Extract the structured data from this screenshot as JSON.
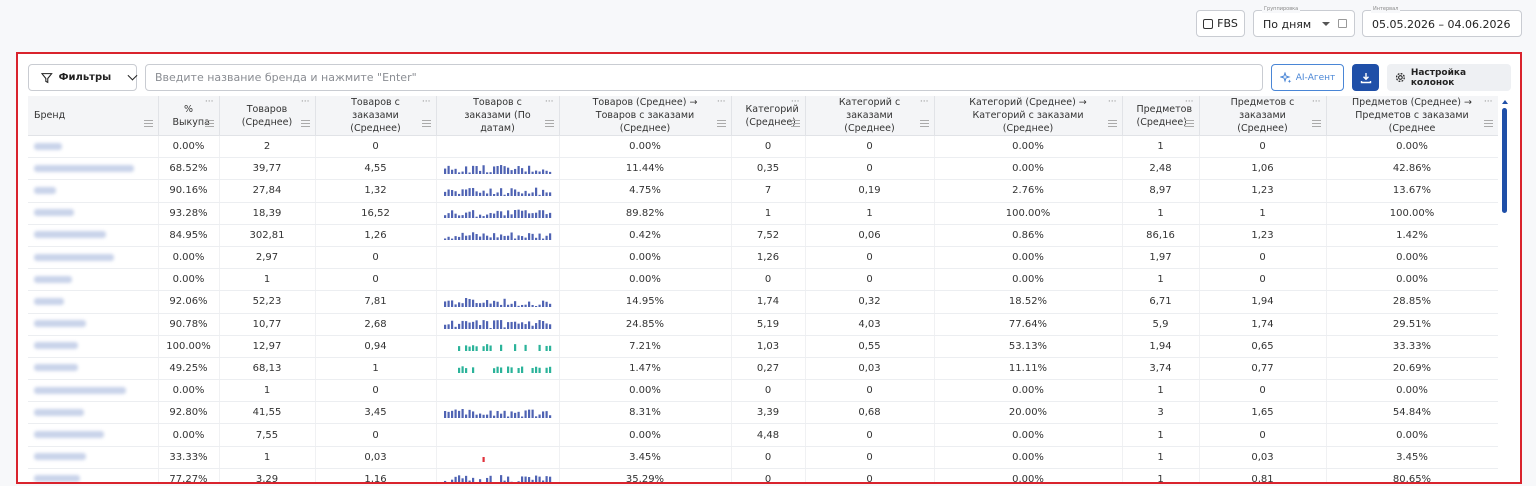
{
  "toolbar": {
    "fbs_label": "FBS",
    "grouping_label": "Группировка",
    "grouping_value": "По дням",
    "interval_label": "Интервал",
    "interval_value": "05.05.2026 – 04.06.2026"
  },
  "panel": {
    "filters_label": "Фильтры",
    "search_placeholder": "Введите название бренда и нажмите \"Enter\"",
    "ai_label": "AI-Агент",
    "columns_settings_label": "Настройка колонок"
  },
  "colors": {
    "accent": "#1f4fa8",
    "spark_blue": "#4f63b3",
    "spark_teal": "#2bb39a",
    "spark_red": "#e0323c",
    "highlight_border": "#d9232d"
  },
  "table": {
    "headers": [
      "Бренд",
      "% Выкупа",
      "Товаров (Среднее)",
      "Товаров с заказами (Среднее)",
      "Товаров с заказами (По датам)",
      "Товаров (Среднее) → Товаров с заказами (Среднее)",
      "Категорий (Среднее)",
      "Категорий с заказами (Среднее)",
      "Категорий (Среднее) → Категорий с заказами (Среднее)",
      "Предметов (Среднее)",
      "Предметов с заказами (Среднее)",
      "Предметов (Среднее) → Предметов с заказами (Среднее"
    ],
    "rows": [
      {
        "buyout": "0.00%",
        "goods": "2",
        "goods_orders": "0",
        "spark": "none",
        "goods_conv": "0.00%",
        "cats": "0",
        "cats_orders": "0",
        "cats_conv": "0.00%",
        "items": "1",
        "items_orders": "0",
        "items_conv": "0.00%"
      },
      {
        "buyout": "68.52%",
        "goods": "39,77",
        "goods_orders": "4,55",
        "spark": "blue",
        "goods_conv": "11.44%",
        "cats": "0,35",
        "cats_orders": "0",
        "cats_conv": "0.00%",
        "items": "2,48",
        "items_orders": "1,06",
        "items_conv": "42.86%"
      },
      {
        "buyout": "90.16%",
        "goods": "27,84",
        "goods_orders": "1,32",
        "spark": "blue",
        "goods_conv": "4.75%",
        "cats": "7",
        "cats_orders": "0,19",
        "cats_conv": "2.76%",
        "items": "8,97",
        "items_orders": "1,23",
        "items_conv": "13.67%"
      },
      {
        "buyout": "93.28%",
        "goods": "18,39",
        "goods_orders": "16,52",
        "spark": "blue",
        "goods_conv": "89.82%",
        "cats": "1",
        "cats_orders": "1",
        "cats_conv": "100.00%",
        "items": "1",
        "items_orders": "1",
        "items_conv": "100.00%"
      },
      {
        "buyout": "84.95%",
        "goods": "302,81",
        "goods_orders": "1,26",
        "spark": "blue",
        "goods_conv": "0.42%",
        "cats": "7,52",
        "cats_orders": "0,06",
        "cats_conv": "0.86%",
        "items": "86,16",
        "items_orders": "1,23",
        "items_conv": "1.42%"
      },
      {
        "buyout": "0.00%",
        "goods": "2,97",
        "goods_orders": "0",
        "spark": "none",
        "goods_conv": "0.00%",
        "cats": "1,26",
        "cats_orders": "0",
        "cats_conv": "0.00%",
        "items": "1,97",
        "items_orders": "0",
        "items_conv": "0.00%"
      },
      {
        "buyout": "0.00%",
        "goods": "1",
        "goods_orders": "0",
        "spark": "none",
        "goods_conv": "0.00%",
        "cats": "0",
        "cats_orders": "0",
        "cats_conv": "0.00%",
        "items": "1",
        "items_orders": "0",
        "items_conv": "0.00%"
      },
      {
        "buyout": "92.06%",
        "goods": "52,23",
        "goods_orders": "7,81",
        "spark": "blue",
        "goods_conv": "14.95%",
        "cats": "1,74",
        "cats_orders": "0,32",
        "cats_conv": "18.52%",
        "items": "6,71",
        "items_orders": "1,94",
        "items_conv": "28.85%"
      },
      {
        "buyout": "90.78%",
        "goods": "10,77",
        "goods_orders": "2,68",
        "spark": "blue",
        "goods_conv": "24.85%",
        "cats": "5,19",
        "cats_orders": "4,03",
        "cats_conv": "77.64%",
        "items": "5,9",
        "items_orders": "1,74",
        "items_conv": "29.51%"
      },
      {
        "buyout": "100.00%",
        "goods": "12,97",
        "goods_orders": "0,94",
        "spark": "teal",
        "goods_conv": "7.21%",
        "cats": "1,03",
        "cats_orders": "0,55",
        "cats_conv": "53.13%",
        "items": "1,94",
        "items_orders": "0,65",
        "items_conv": "33.33%"
      },
      {
        "buyout": "49.25%",
        "goods": "68,13",
        "goods_orders": "1",
        "spark": "teal",
        "goods_conv": "1.47%",
        "cats": "0,27",
        "cats_orders": "0,03",
        "cats_conv": "11.11%",
        "items": "3,74",
        "items_orders": "0,77",
        "items_conv": "20.69%"
      },
      {
        "buyout": "0.00%",
        "goods": "1",
        "goods_orders": "0",
        "spark": "none",
        "goods_conv": "0.00%",
        "cats": "0",
        "cats_orders": "0",
        "cats_conv": "0.00%",
        "items": "1",
        "items_orders": "0",
        "items_conv": "0.00%"
      },
      {
        "buyout": "92.80%",
        "goods": "41,55",
        "goods_orders": "3,45",
        "spark": "blue",
        "goods_conv": "8.31%",
        "cats": "3,39",
        "cats_orders": "0,68",
        "cats_conv": "20.00%",
        "items": "3",
        "items_orders": "1,65",
        "items_conv": "54.84%"
      },
      {
        "buyout": "0.00%",
        "goods": "7,55",
        "goods_orders": "0",
        "spark": "none",
        "goods_conv": "0.00%",
        "cats": "4,48",
        "cats_orders": "0",
        "cats_conv": "0.00%",
        "items": "1",
        "items_orders": "0",
        "items_conv": "0.00%"
      },
      {
        "buyout": "33.33%",
        "goods": "1",
        "goods_orders": "0,03",
        "spark": "red",
        "goods_conv": "3.45%",
        "cats": "0",
        "cats_orders": "0",
        "cats_conv": "0.00%",
        "items": "1",
        "items_orders": "0,03",
        "items_conv": "3.45%"
      },
      {
        "buyout": "77.27%",
        "goods": "3,29",
        "goods_orders": "1,16",
        "spark": "blue",
        "goods_conv": "35.29%",
        "cats": "0",
        "cats_orders": "0",
        "cats_conv": "0.00%",
        "items": "1",
        "items_orders": "0,81",
        "items_conv": "80.65%"
      }
    ]
  }
}
